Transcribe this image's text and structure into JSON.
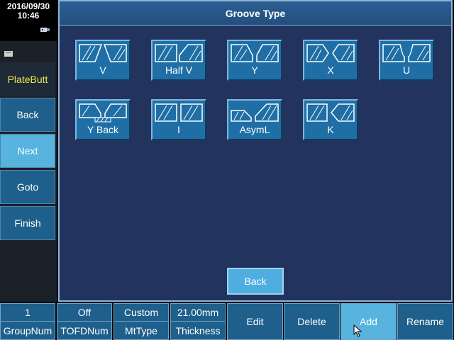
{
  "status": {
    "date": "2016/09/30",
    "time": "10:46"
  },
  "sidebar": {
    "mode": "PlateButt",
    "items": [
      {
        "label": "Back",
        "active": false
      },
      {
        "label": "Next",
        "active": true
      },
      {
        "label": "Goto",
        "active": false
      },
      {
        "label": "Finish",
        "active": false
      }
    ]
  },
  "main": {
    "title": "Groove Type",
    "grooves": [
      {
        "label": "V",
        "icon": "v-groove-icon"
      },
      {
        "label": "Half V",
        "icon": "half-v-groove-icon"
      },
      {
        "label": "Y",
        "icon": "y-groove-icon"
      },
      {
        "label": "X",
        "icon": "x-groove-icon"
      },
      {
        "label": "U",
        "icon": "u-groove-icon"
      },
      {
        "label": "Y Back",
        "icon": "y-back-groove-icon"
      },
      {
        "label": "I",
        "icon": "i-groove-icon"
      },
      {
        "label": "AsymL",
        "icon": "asym-l-groove-icon"
      },
      {
        "label": "K",
        "icon": "k-groove-icon"
      }
    ],
    "back_label": "Back"
  },
  "bottom": {
    "params": [
      {
        "value": "1",
        "name": "GroupNum"
      },
      {
        "value": "Off",
        "name": "TOFDNum"
      },
      {
        "value": "Custom",
        "name": "MtType"
      },
      {
        "value": "21.00mm",
        "name": "Thickness"
      }
    ],
    "actions": [
      {
        "label": "Edit",
        "active": false
      },
      {
        "label": "Delete",
        "active": false
      },
      {
        "label": "Add",
        "active": true
      },
      {
        "label": "Rename",
        "active": false
      }
    ]
  },
  "colors": {
    "panel": "#22335e",
    "button": "#1f5f8b",
    "active": "#58b3de",
    "mode_text": "#e7e84e"
  }
}
